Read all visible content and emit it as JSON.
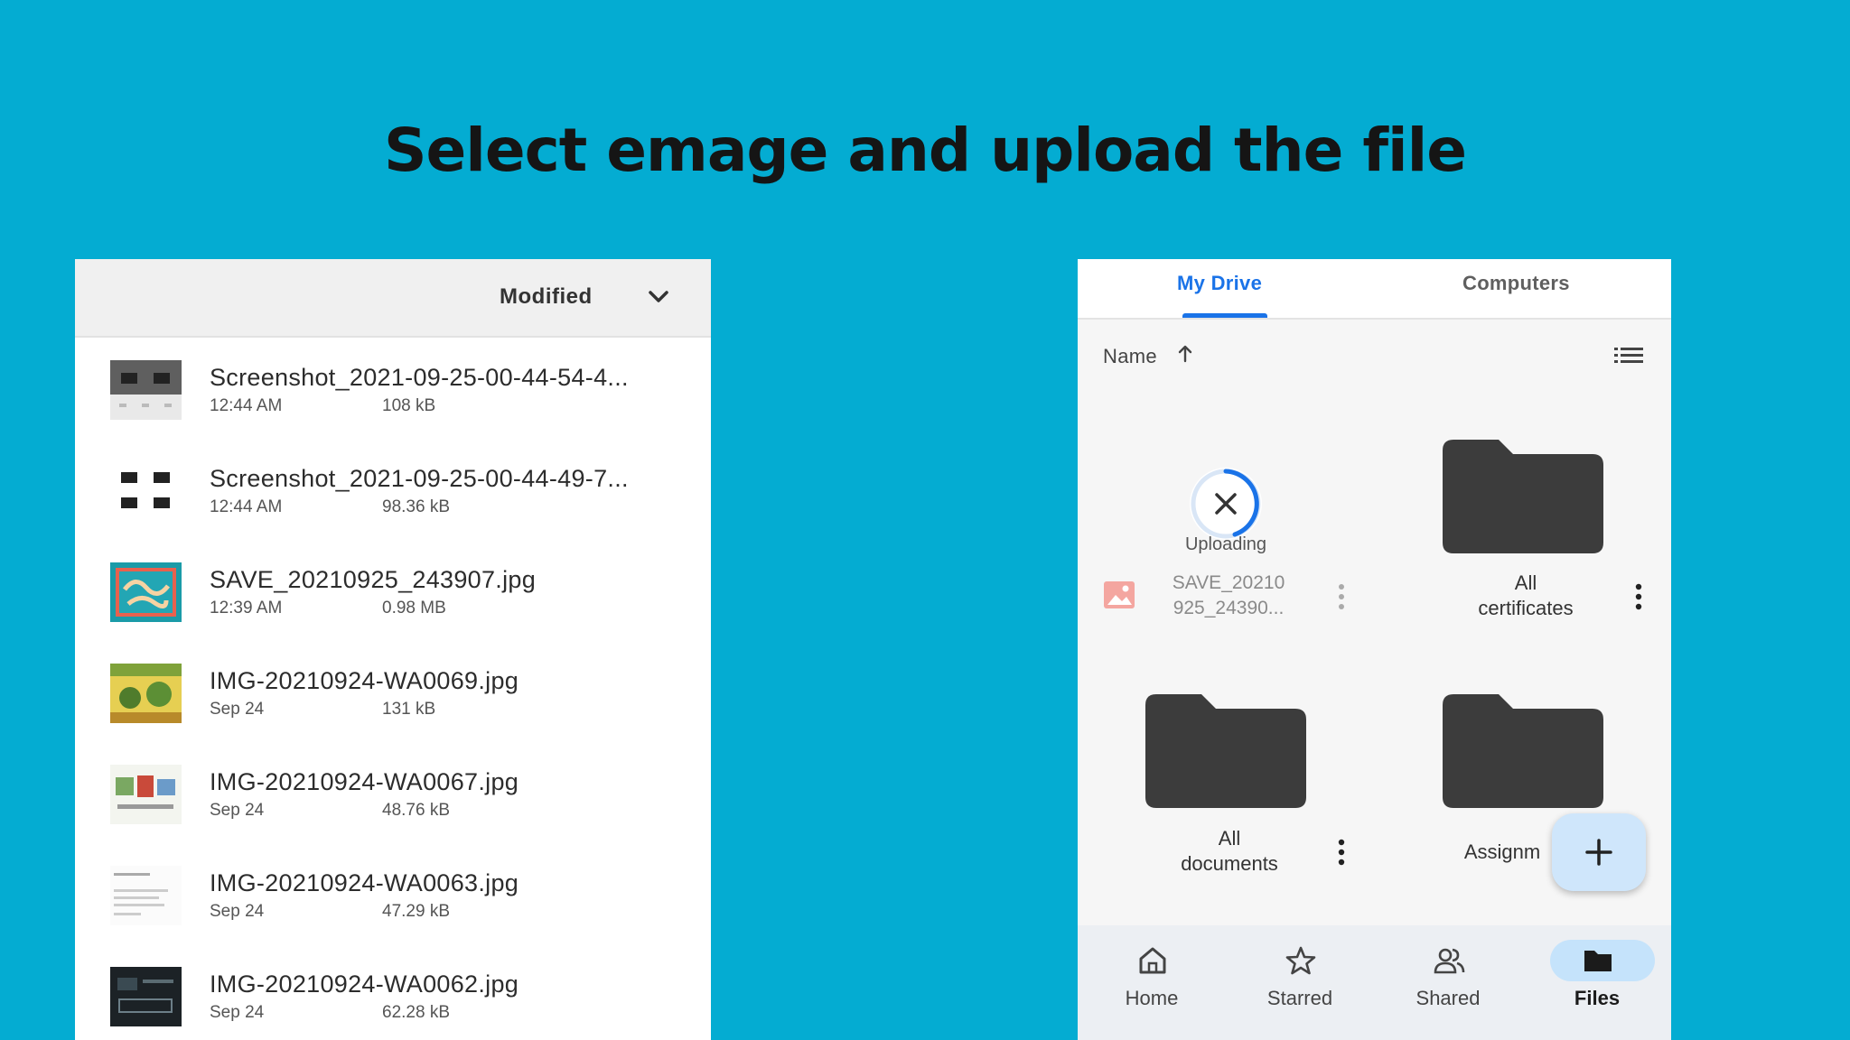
{
  "slide": {
    "title": "Select emage and upload the file"
  },
  "picker": {
    "sort_label": "Modified",
    "files": [
      {
        "name": "Screenshot_2021-09-25-00-44-54-4...",
        "time": "12:44 AM",
        "size": "108 kB",
        "thumb": "screenshot"
      },
      {
        "name": "Screenshot_2021-09-25-00-44-49-7...",
        "time": "12:44 AM",
        "size": "98.36 kB",
        "thumb": "screenshot-grid"
      },
      {
        "name": "SAVE_20210925_243907.jpg",
        "time": "12:39 AM",
        "size": "0.98 MB",
        "thumb": "thank-you"
      },
      {
        "name": "IMG-20210924-WA0069.jpg",
        "time": "Sep 24",
        "size": "131 kB",
        "thumb": "yellow-art"
      },
      {
        "name": "IMG-20210924-WA0067.jpg",
        "time": "Sep 24",
        "size": "48.76 kB",
        "thumb": "poster"
      },
      {
        "name": "IMG-20210924-WA0063.jpg",
        "time": "Sep 24",
        "size": "47.29 kB",
        "thumb": "document"
      },
      {
        "name": "IMG-20210924-WA0062.jpg",
        "time": "Sep 24",
        "size": "62.28 kB",
        "thumb": "dark-screen"
      }
    ]
  },
  "drive": {
    "tabs": [
      {
        "label": "My Drive",
        "active": true
      },
      {
        "label": "Computers",
        "active": false
      }
    ],
    "sort_label": "Name",
    "uploading": {
      "status": "Uploading",
      "name_line1": "SAVE_20210",
      "name_line2": "925_24390..."
    },
    "folders": [
      {
        "line1": "All",
        "line2": "certificates"
      },
      {
        "line1": "All",
        "line2": "documents"
      },
      {
        "line1": "Assignm",
        "line2": ""
      }
    ],
    "fab_icon": "plus-icon",
    "nav": [
      {
        "label": "Home",
        "icon": "home-icon",
        "active": false
      },
      {
        "label": "Starred",
        "icon": "star-icon",
        "active": false
      },
      {
        "label": "Shared",
        "icon": "shared-icon",
        "active": false
      },
      {
        "label": "Files",
        "icon": "folder-icon",
        "active": true
      }
    ]
  },
  "colors": {
    "background": "#04acd2",
    "accent_blue": "#1a73e8",
    "folder_gray": "#3c3c3c",
    "fab_bg": "#cfe6fb"
  }
}
